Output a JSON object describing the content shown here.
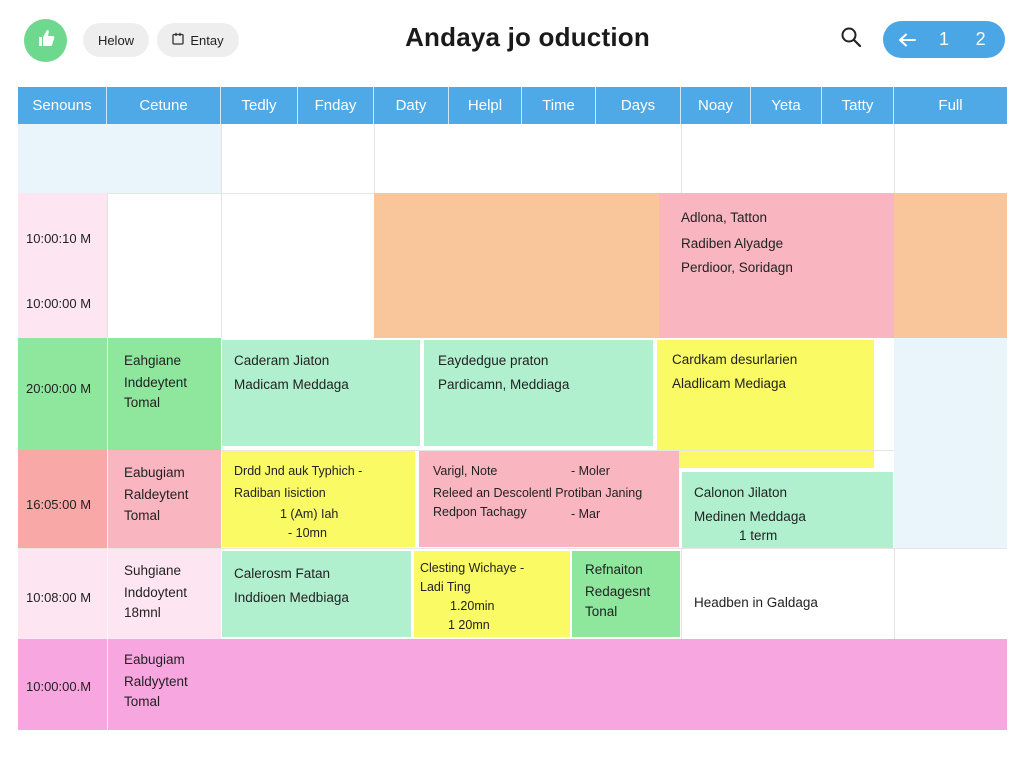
{
  "header": {
    "title": "Andaya jo oduction",
    "buttons": [
      "Helow",
      "Entay"
    ],
    "pager": {
      "back_icon": "arrow-left-icon",
      "pages": [
        "1",
        "2"
      ]
    }
  },
  "columns": [
    "Senouns",
    "Cetune",
    "Tedly",
    "Fnday",
    "Daty",
    "Helpl",
    "Time",
    "Days",
    "Noay",
    "Yeta",
    "Tatty",
    "Full"
  ],
  "times": [
    "10:00:10 M",
    "10:00:00 M",
    "20:00:00 M",
    "16:05:00 M",
    "10:08:00 M",
    "10:00:00.M"
  ],
  "events": {
    "orange_right_pink": [
      "Adlona, Tatton",
      "Radiben Alyadge",
      "Perdioor, Soridagn"
    ],
    "r3_name": [
      "Eahgiane",
      "Inddeytent",
      "Tomal"
    ],
    "r3_a": [
      "Caderam Jiaton",
      "Madicam Meddaga"
    ],
    "r3_b": [
      "Eaydedgue praton",
      "Pardicamn, Meddiaga"
    ],
    "r3_c": [
      "Cardkam desurlarien",
      "Aladlicam Mediaga"
    ],
    "r4_name": [
      "Eabugiam",
      "Raldeytent",
      "Tomal"
    ],
    "r4_a": [
      "Drdd Jnd auk Typhich -",
      "Radiban Iisiction",
      "1 (Am) Iah",
      "- 10mn"
    ],
    "r4_b": [
      "Varigl, Note",
      "- Moler",
      "Releed an Descolentl Protiban Janing",
      "Redpon Tachagy",
      "- Mar"
    ],
    "r4_c": [
      "Calonon Jilaton",
      "Medinen Meddaga",
      "1 term"
    ],
    "r5_name": [
      "Suhgiane",
      "Inddoytent",
      "18mnl"
    ],
    "r5_a": [
      "Calerosm Fatan",
      "Inddioen Medbiaga"
    ],
    "r5_b": [
      "Clesting Wichaye -",
      "Ladi Ting",
      "1.20min",
      "1 20mn"
    ],
    "r5_c": [
      "Refnaiton",
      "Redagesnt",
      "Tonal"
    ],
    "r5_d": [
      "Headben in Galdaga"
    ],
    "r6_name": [
      "Eabugiam",
      "Raldyytent",
      "Tomal"
    ]
  },
  "colors": {
    "header_blue": "#4fa9e6",
    "logo_green": "#6fd88f",
    "orange": "#f9c59b",
    "pink": "#f9b5c0",
    "green": "#8fe79d",
    "mint": "#b1f0cf",
    "yellow": "#fafa65",
    "magenta": "#f8a6e0"
  },
  "icons": {
    "logo": "thumbs-up-icon",
    "calendar": "calendar-icon",
    "search": "search-icon"
  }
}
